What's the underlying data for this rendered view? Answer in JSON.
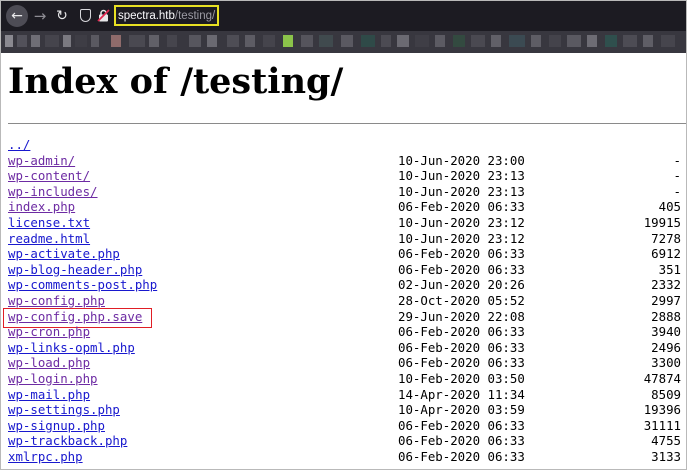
{
  "browser": {
    "url_host": "spectra.htb",
    "url_path": "/testing/",
    "icons": {
      "back": "back-arrow-icon",
      "forward": "forward-arrow-icon",
      "reload": "reload-icon",
      "tracking": "shield-icon",
      "security": "insecure-lock-icon"
    },
    "colors": {
      "toolbar": "#1c1b22",
      "bookmarks_bar": "#38373f",
      "url_highlight": "#e8e023"
    }
  },
  "page": {
    "title": "Index of /testing/",
    "parent_link": "../",
    "entries": [
      {
        "name": "wp-admin/",
        "date": "10-Jun-2020 23:00",
        "size": "-",
        "visited": true
      },
      {
        "name": "wp-content/",
        "date": "10-Jun-2020 23:13",
        "size": "-",
        "visited": true
      },
      {
        "name": "wp-includes/",
        "date": "10-Jun-2020 23:13",
        "size": "-",
        "visited": true
      },
      {
        "name": "index.php",
        "date": "06-Feb-2020 06:33",
        "size": "405",
        "visited": true
      },
      {
        "name": "license.txt",
        "date": "10-Jun-2020 23:12",
        "size": "19915",
        "visited": false
      },
      {
        "name": "readme.html",
        "date": "10-Jun-2020 23:12",
        "size": "7278",
        "visited": false
      },
      {
        "name": "wp-activate.php",
        "date": "06-Feb-2020 06:33",
        "size": "6912",
        "visited": false
      },
      {
        "name": "wp-blog-header.php",
        "date": "06-Feb-2020 06:33",
        "size": "351",
        "visited": false
      },
      {
        "name": "wp-comments-post.php",
        "date": "02-Jun-2020 20:26",
        "size": "2332",
        "visited": false
      },
      {
        "name": "wp-config.php",
        "date": "28-Oct-2020 05:52",
        "size": "2997",
        "visited": true
      },
      {
        "name": "wp-config.php.save",
        "date": "29-Jun-2020 22:08",
        "size": "2888",
        "visited": true,
        "highlighted": true
      },
      {
        "name": "wp-cron.php",
        "date": "06-Feb-2020 06:33",
        "size": "3940",
        "visited": true
      },
      {
        "name": "wp-links-opml.php",
        "date": "06-Feb-2020 06:33",
        "size": "2496",
        "visited": false
      },
      {
        "name": "wp-load.php",
        "date": "06-Feb-2020 06:33",
        "size": "3300",
        "visited": true
      },
      {
        "name": "wp-login.php",
        "date": "10-Feb-2020 03:50",
        "size": "47874",
        "visited": true
      },
      {
        "name": "wp-mail.php",
        "date": "14-Apr-2020 11:34",
        "size": "8509",
        "visited": false
      },
      {
        "name": "wp-settings.php",
        "date": "10-Apr-2020 03:59",
        "size": "19396",
        "visited": false
      },
      {
        "name": "wp-signup.php",
        "date": "06-Feb-2020 06:33",
        "size": "31111",
        "visited": false
      },
      {
        "name": "wp-trackback.php",
        "date": "06-Feb-2020 06:33",
        "size": "4755",
        "visited": false
      },
      {
        "name": "xmlrpc.php",
        "date": "06-Feb-2020 06:33",
        "size": "3133",
        "visited": false
      }
    ],
    "colors": {
      "link": "#1818ce",
      "visited_link": "#6d2ba3",
      "annotation_box": "#e01e25"
    }
  }
}
